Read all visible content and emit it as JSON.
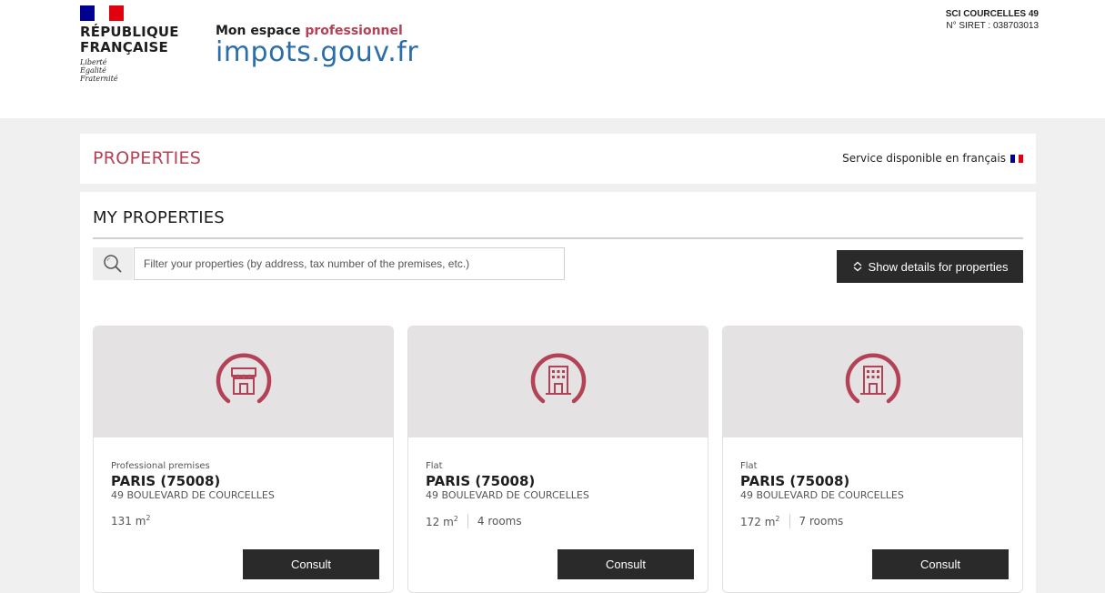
{
  "header": {
    "republic_name_line1": "RÉPUBLIQUE",
    "republic_name_line2": "FRANÇAISE",
    "motto_line1": "Liberté",
    "motto_line2": "Égalité",
    "motto_line3": "Fraternité",
    "brand_prefix": "Mon espace ",
    "brand_prefix_accent": "professionnel",
    "brand_main": "impots.gouv.fr",
    "company_name": "SCI COURCELLES 49",
    "company_siret": "N° SIRET : 038703013"
  },
  "title_bar": {
    "page_title": "PROPERTIES",
    "language_link": "Service disponible en français"
  },
  "properties": {
    "section_title": "MY PROPERTIES",
    "search_placeholder": "Filter your properties (by address, tax number of the premises, etc.)",
    "details_button_label": "Show details for properties",
    "cards": [
      {
        "type": "Professional premises",
        "city": "PARIS  (75008)",
        "address": "49 BOULEVARD DE COURCELLES",
        "area": "131 m",
        "area_unit_exp": "2",
        "rooms": "",
        "consult_label": "Consult",
        "icon": "shop-icon"
      },
      {
        "type": "Flat",
        "city": "PARIS  (75008)",
        "address": "49 BOULEVARD DE COURCELLES",
        "area": "12 m",
        "area_unit_exp": "2",
        "rooms": "4 rooms",
        "consult_label": "Consult",
        "icon": "building-icon"
      },
      {
        "type": "Flat",
        "city": "PARIS  (75008)",
        "address": "49 BOULEVARD DE COURCELLES",
        "area": "172 m",
        "area_unit_exp": "2",
        "rooms": "7 rooms",
        "consult_label": "Consult",
        "icon": "building-icon"
      }
    ]
  },
  "colors": {
    "accent": "#b34256",
    "brand_blue": "#2b6ea8",
    "button_dark": "#2a2a2a",
    "card_top_bg": "#e4e2e2",
    "page_bg": "#f0f0f0"
  }
}
